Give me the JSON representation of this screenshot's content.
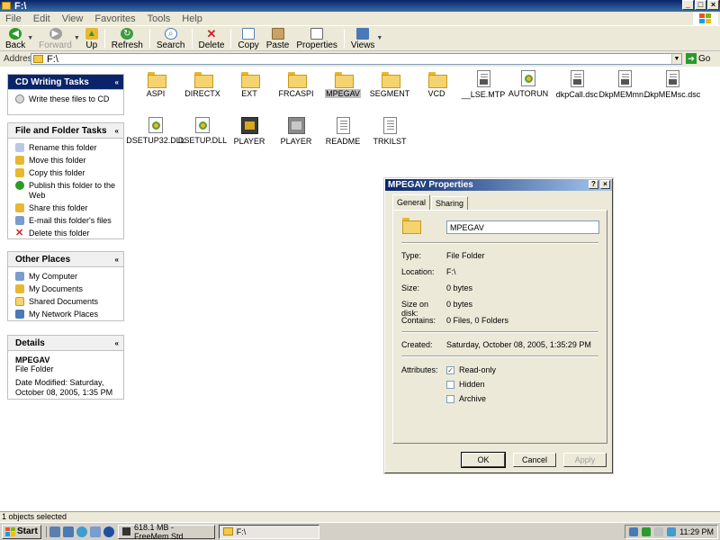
{
  "window": {
    "title": "F:\\",
    "buttons": {
      "minimize": "_",
      "maximize": "□",
      "close": "×"
    }
  },
  "menu": [
    "File",
    "Edit",
    "View",
    "Favorites",
    "Tools",
    "Help"
  ],
  "toolbar": {
    "back": "Back",
    "forward": "Forward",
    "up": "Up",
    "refresh": "Refresh",
    "search": "Search",
    "delete": "Delete",
    "copy": "Copy",
    "paste": "Paste",
    "properties": "Properties",
    "views": "Views"
  },
  "address": {
    "label": "Address",
    "value": "F:\\",
    "go": "Go"
  },
  "tasks": {
    "cd": {
      "title": "CD Writing Tasks",
      "items": [
        "Write these files to CD"
      ]
    },
    "file_folder": {
      "title": "File and Folder Tasks",
      "items": [
        "Rename this folder",
        "Move this folder",
        "Copy this folder",
        "Publish this folder to the Web",
        "Share this folder",
        "E-mail this folder's files",
        "Delete this folder"
      ]
    },
    "other": {
      "title": "Other Places",
      "items": [
        "My Computer",
        "My Documents",
        "Shared Documents",
        "My Network Places"
      ]
    },
    "details": {
      "title": "Details",
      "name": "MPEGAV",
      "type": "File Folder",
      "modified": "Date Modified: Saturday, October 08, 2005, 1:35 PM"
    }
  },
  "files": [
    {
      "name": "ASPI",
      "icon": "folder-icon"
    },
    {
      "name": "DIRECTX",
      "icon": "folder-icon"
    },
    {
      "name": "EXT",
      "icon": "folder-icon"
    },
    {
      "name": "FRCASPI",
      "icon": "folder-icon"
    },
    {
      "name": "MPEGAV",
      "icon": "folder-icon",
      "selected": true
    },
    {
      "name": "SEGMENT",
      "icon": "folder-icon"
    },
    {
      "name": "VCD",
      "icon": "folder-icon"
    },
    {
      "name": "__LSE.MTP",
      "icon": "document-icon"
    },
    {
      "name": "AUTORUN",
      "icon": "autorun-icon"
    },
    {
      "name": "dkpCall.dsc",
      "icon": "document-icon"
    },
    {
      "name": "DkpMEMmn...",
      "icon": "document-icon"
    },
    {
      "name": "DkpMEMsc.dsc",
      "icon": "document-icon"
    },
    {
      "name": "DSETUP32.DLL",
      "icon": "dll-icon"
    },
    {
      "name": "DSETUP.DLL",
      "icon": "dll-icon"
    },
    {
      "name": "PLAYER",
      "icon": "player-icon"
    },
    {
      "name": "PLAYER",
      "icon": "player-icon"
    },
    {
      "name": "README",
      "icon": "text-icon"
    },
    {
      "name": "TRKILST",
      "icon": "text-icon"
    }
  ],
  "dialog": {
    "title": "MPEGAV Properties",
    "help": "?",
    "close": "×",
    "tabs": [
      "General",
      "Sharing"
    ],
    "folder_name": "MPEGAV",
    "rows": [
      {
        "k": "Type:",
        "v": "File Folder"
      },
      {
        "k": "Location:",
        "v": "F:\\"
      },
      {
        "k": "Size:",
        "v": "0 bytes"
      },
      {
        "k": "Size on disk:",
        "v": "0 bytes"
      },
      {
        "k": "Contains:",
        "v": "0 Files, 0 Folders"
      },
      {
        "k": "Created:",
        "v": "Saturday, October 08, 2005, 1:35:29 PM"
      }
    ],
    "attributes_label": "Attributes:",
    "attributes": [
      {
        "label": "Read-only",
        "checked": true
      },
      {
        "label": "Hidden",
        "checked": false
      },
      {
        "label": "Archive",
        "checked": false
      }
    ],
    "ok": "OK",
    "cancel": "Cancel",
    "apply": "Apply"
  },
  "status": "1 objects selected",
  "taskbar": {
    "start": "Start",
    "task1": "618.1 MB - FreeMem Std",
    "task2": "F:\\",
    "clock": "11:29 PM"
  }
}
